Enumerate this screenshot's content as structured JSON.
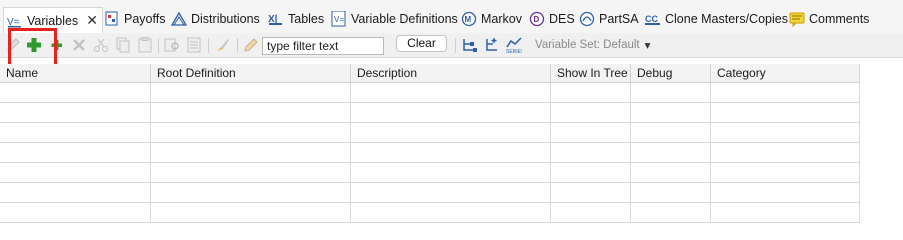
{
  "tabs": [
    {
      "label": "Variables",
      "icon": "variables-icon",
      "active": true
    },
    {
      "label": "Payoffs",
      "icon": "payoffs-icon"
    },
    {
      "label": "Distributions",
      "icon": "distributions-icon"
    },
    {
      "label": "Tables",
      "icon": "tables-icon"
    },
    {
      "label": "Variable Definitions",
      "icon": "variable-definitions-icon"
    },
    {
      "label": "Markov",
      "icon": "markov-icon"
    },
    {
      "label": "DES",
      "icon": "des-icon"
    },
    {
      "label": "PartSA",
      "icon": "partsa-icon"
    },
    {
      "label": "Clone Masters/Copies",
      "icon": "clone-masters-icon"
    },
    {
      "label": "Comments",
      "icon": "comments-icon"
    }
  ],
  "toolbar": {
    "filter_placeholder": "type filter text",
    "clear_label": "Clear",
    "variable_set_label": "Variable Set: Default",
    "dropdown_glyph": "▾",
    "close_glyph": "✕"
  },
  "table": {
    "columns": [
      "Name",
      "Root Definition",
      "Description",
      "Show In Tree",
      "Debug",
      "Category"
    ]
  },
  "colors": {
    "highlight": "#e8211d",
    "add_green": "#2e9b2e",
    "icon_blue": "#2f5fa8"
  }
}
